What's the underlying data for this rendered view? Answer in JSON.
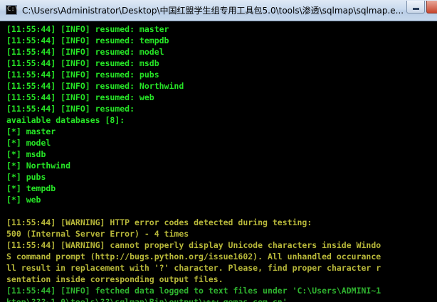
{
  "window": {
    "title": "C:\\Users\\Administrator\\Desktop\\中国红盟学生组专用工具包5.0\\tools\\渗透\\sqlmap\\sqlmap.e...",
    "app_icon": "command-prompt-icon",
    "app_icon_glyph": "C:\\",
    "close_button_color": "#c7452c"
  },
  "colors": {
    "background": "#000000",
    "info_text": "#26e626",
    "warning_text": "#b8b83a",
    "faded_info_text": "#2fb22f"
  },
  "console": {
    "lines": [
      {
        "text": "[11:55:44] [INFO] resumed: master",
        "style": "bright"
      },
      {
        "text": "[11:55:44] [INFO] resumed: tempdb",
        "style": "bright"
      },
      {
        "text": "[11:55:44] [INFO] resumed: model",
        "style": "bright"
      },
      {
        "text": "[11:55:44] [INFO] resumed: msdb",
        "style": "bright"
      },
      {
        "text": "[11:55:44] [INFO] resumed: pubs",
        "style": "bright"
      },
      {
        "text": "[11:55:44] [INFO] resumed: Northwind",
        "style": "bright"
      },
      {
        "text": "[11:55:44] [INFO] resumed: web",
        "style": "bright"
      },
      {
        "text": "[11:55:44] [INFO] resumed:",
        "style": "bright"
      },
      {
        "text": "available databases [8]:",
        "style": "bright"
      },
      {
        "text": "[*] master",
        "style": "bright"
      },
      {
        "text": "[*] model",
        "style": "bright"
      },
      {
        "text": "[*] msdb",
        "style": "bright"
      },
      {
        "text": "[*] Northwind",
        "style": "bright"
      },
      {
        "text": "[*] pubs",
        "style": "bright"
      },
      {
        "text": "[*] tempdb",
        "style": "bright"
      },
      {
        "text": "[*] web",
        "style": "bright"
      },
      {
        "text": "",
        "style": "bright"
      },
      {
        "text": "[11:55:44] [WARNING] HTTP error codes detected during testing:",
        "style": "warn"
      },
      {
        "text": "500 (Internal Server Error) - 4 times",
        "style": "warn"
      },
      {
        "text": "[11:55:44] [WARNING] cannot properly display Unicode characters inside Windo",
        "style": "warn"
      },
      {
        "text": "S command prompt (http://bugs.python.org/issue1602). All unhandled occurance",
        "style": "warn"
      },
      {
        "text": "ll result in replacement with '?' character. Please, find proper character r",
        "style": "warn"
      },
      {
        "text": "sentation inside corresponding output files.",
        "style": "warn"
      },
      {
        "text": "[11:55:44] [INFO] fetched data logged to text files under 'C:\\Users\\ADMINI~1",
        "style": "dim"
      },
      {
        "text": "ktop\\???~1.0\\tools\\??\\sqlmap\\Bin\\output\\www.gemas.com.cn'",
        "style": "dim"
      }
    ]
  }
}
